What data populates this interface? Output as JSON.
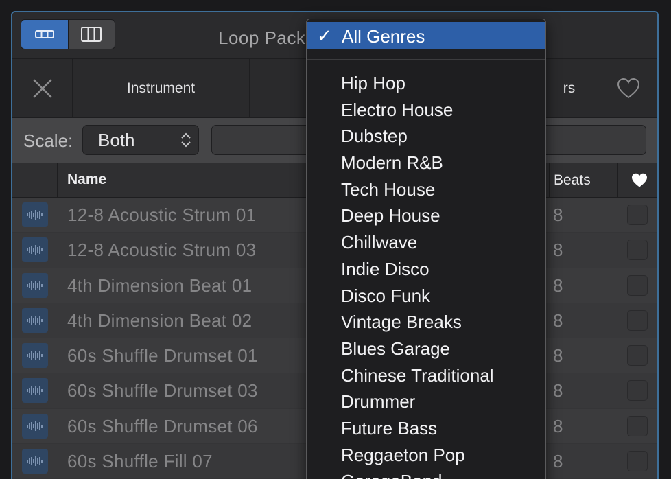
{
  "toolbar": {
    "title": "Loop Pack",
    "view_buttons": [
      {
        "name": "button-view",
        "active": true
      },
      {
        "name": "column-view",
        "active": false
      }
    ]
  },
  "tabs": {
    "instrument_label": "Instrument",
    "partial_label": "rs"
  },
  "filters": {
    "scale_label": "Scale:",
    "scale_value": "Both",
    "search_value": ""
  },
  "table": {
    "headers": {
      "name": "Name",
      "beats": "Beats"
    },
    "rows": [
      {
        "name": "12-8 Acoustic Strum 01",
        "beats": "8"
      },
      {
        "name": "12-8 Acoustic Strum 03",
        "beats": "8"
      },
      {
        "name": "4th Dimension Beat 01",
        "beats": "8"
      },
      {
        "name": "4th Dimension Beat 02",
        "beats": "8"
      },
      {
        "name": "60s Shuffle Drumset 01",
        "beats": "8"
      },
      {
        "name": "60s Shuffle Drumset 03",
        "beats": "8"
      },
      {
        "name": "60s Shuffle Drumset 06",
        "beats": "8"
      },
      {
        "name": "60s Shuffle Fill 07",
        "beats": "8"
      }
    ]
  },
  "genre_menu": {
    "check": "✓",
    "selected": "All Genres",
    "items": [
      "Hip Hop",
      "Electro House",
      "Dubstep",
      "Modern R&B",
      "Tech House",
      "Deep House",
      "Chillwave",
      "Indie Disco",
      "Disco Funk",
      "Vintage Breaks",
      "Blues Garage",
      "Chinese Traditional",
      "Drummer",
      "Future Bass",
      "Reggaeton Pop",
      "GarageBand"
    ]
  },
  "colors": {
    "accent": "#3a6fb8",
    "menu_highlight": "#2d5fa8",
    "window_border": "#3e6f99"
  },
  "icons": {
    "close": "close-icon",
    "heart_outline": "heart-outline-icon",
    "heart_filled": "heart-icon",
    "waveform": "waveform-icon",
    "stepper": "chevron-updown-icon"
  }
}
